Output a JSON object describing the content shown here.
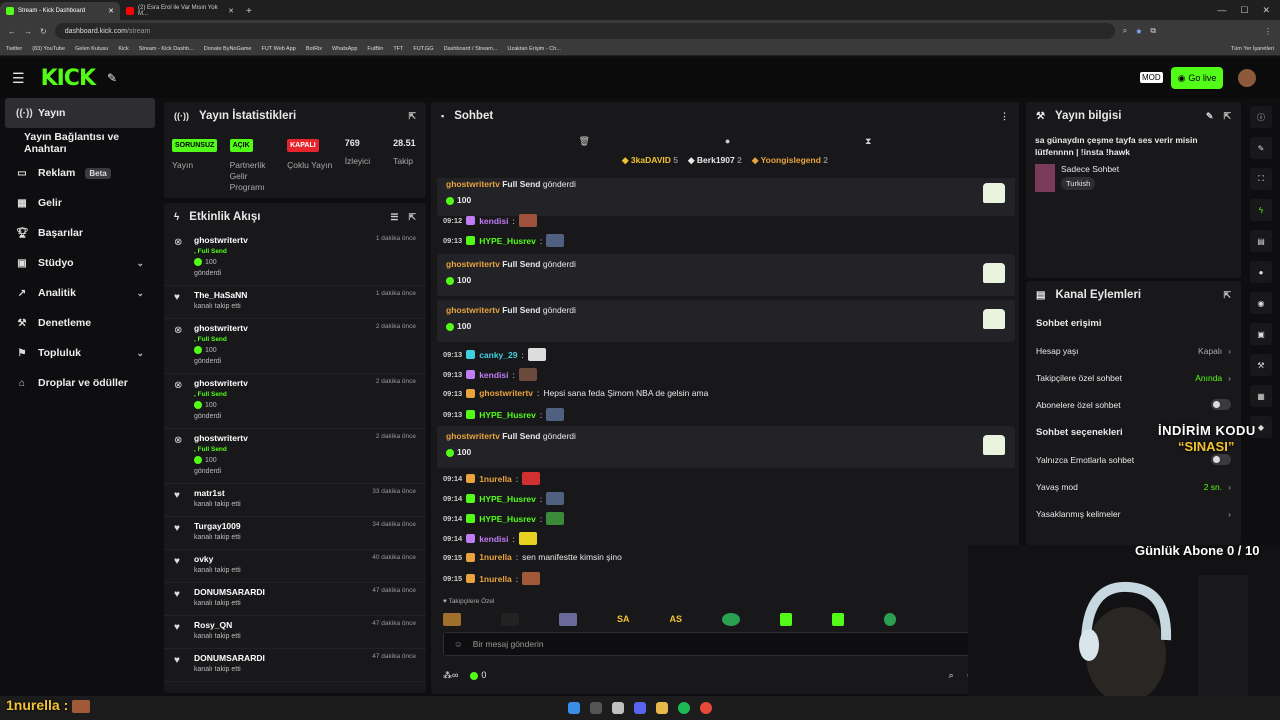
{
  "browser": {
    "tabs": [
      {
        "title": "Stream - Kick Dashboard",
        "active": true,
        "color": "#53fc18"
      },
      {
        "title": "(2) Esra Erol ile Var Mısın Yok M...",
        "active": false,
        "color": "#ff0000"
      }
    ],
    "url_host": "dashboard.kick.com",
    "url_path": "/stream",
    "bookmarks": [
      "Twitter",
      "(83) YouTube",
      "Gelen Kutusu",
      "Kick",
      "Stream - Kick Dashb...",
      "Donate ByNoGame",
      "FUT Web App",
      "BotRix",
      "WhatsApp",
      "FutBin",
      "TFT",
      "FUT.GG",
      "Dashboard / Stream...",
      "Uzaktan Erişim - Ch..."
    ],
    "all_bookmarks": "Tüm Yer İşaretleri"
  },
  "topnav": {
    "logo": "KICK",
    "go_live": "Go live"
  },
  "sidebar": {
    "items": [
      {
        "label": "Yayın",
        "icon": "broadcast-icon",
        "active": true
      },
      {
        "label": "Yayın Bağlantısı ve Anahtarı"
      },
      {
        "label": "Reklam",
        "icon": "ad-icon",
        "badge": "Beta"
      },
      {
        "label": "Gelir",
        "icon": "revenue-icon"
      },
      {
        "label": "Başarılar",
        "icon": "trophy-icon"
      },
      {
        "label": "Stüdyo",
        "icon": "studio-icon",
        "chevron": true
      },
      {
        "label": "Analitik",
        "icon": "analytics-icon",
        "chevron": true
      },
      {
        "label": "Denetleme",
        "icon": "moderation-icon"
      },
      {
        "label": "Topluluk",
        "icon": "community-icon",
        "chevron": true
      },
      {
        "label": "Droplar ve ödüller",
        "icon": "drops-icon"
      }
    ]
  },
  "stats": {
    "title": "Yayın İstatistikleri",
    "items": [
      {
        "pill": "SORUNSUZ",
        "label": "Yayın",
        "color": "#53fc18"
      },
      {
        "pill": "AÇIK",
        "label": "Partnerlik Gelir Programı",
        "color": "#53fc18"
      },
      {
        "pill": "KAPALI",
        "label": "Çoklu Yayın",
        "color": "#e5242b"
      },
      {
        "num": "769",
        "label": "İzleyici"
      },
      {
        "num": "28.51",
        "label": "Takip"
      }
    ]
  },
  "activity": {
    "title": "Etkinlik Akışı",
    "events": [
      {
        "user": "ghostwritertv",
        "gift": "Full Send",
        "amount": "100",
        "action": "gönderdi",
        "time": "1 dakika önce",
        "type": "kick"
      },
      {
        "user": "The_HaSaNN",
        "action": "kanalı takip etti",
        "time": "1 dakika önce",
        "type": "follow"
      },
      {
        "user": "ghostwritertv",
        "gift": "Full Send",
        "amount": "100",
        "action": "gönderdi",
        "time": "2 dakika önce",
        "type": "kick"
      },
      {
        "user": "ghostwritertv",
        "gift": "Full Send",
        "amount": "100",
        "action": "gönderdi",
        "time": "2 dakika önce",
        "type": "kick"
      },
      {
        "user": "ghostwritertv",
        "gift": "Full Send",
        "amount": "100",
        "action": "gönderdi",
        "time": "2 dakika önce",
        "type": "kick"
      },
      {
        "user": "matr1st",
        "action": "kanalı takip etti",
        "time": "33 dakika önce",
        "type": "follow"
      },
      {
        "user": "Turgay1009",
        "action": "kanalı takip etti",
        "time": "34 dakika önce",
        "type": "follow"
      },
      {
        "user": "ovky",
        "action": "kanalı takip etti",
        "time": "40 dakika önce",
        "type": "follow"
      },
      {
        "user": "DONUMSARARDI",
        "action": "kanalı takip etti",
        "time": "47 dakika önce",
        "type": "follow"
      },
      {
        "user": "Rosy_QN",
        "action": "kanalı takip etti",
        "time": "47 dakika önce",
        "type": "follow"
      },
      {
        "user": "DONUMSARARDI",
        "action": "kanalı takip etti",
        "time": "47 dakika önce",
        "type": "follow"
      }
    ]
  },
  "chat": {
    "title": "Sohbet",
    "top": [
      {
        "name": "3kaDAVID",
        "count": "5",
        "color": "#f2c230"
      },
      {
        "name": "Berk1907",
        "count": "2",
        "color": "#e8e8e8"
      },
      {
        "name": "Yoongislegend",
        "count": "2",
        "color": "#e8a33c"
      }
    ],
    "messages": [
      {
        "kind": "card",
        "user": "ghostwritertv",
        "gift": "Full Send",
        "action": "gönderdi",
        "amount": "100"
      },
      {
        "kind": "line",
        "time": "09:12",
        "user": "kendisi",
        "text": "",
        "color": "#c07cf5"
      },
      {
        "kind": "line",
        "time": "09:13",
        "user": "HYPE_Husrev",
        "text": "",
        "color": "#53fc18"
      },
      {
        "kind": "card",
        "user": "ghostwritertv",
        "gift": "Full Send",
        "action": "gönderdi",
        "amount": "100"
      },
      {
        "kind": "card",
        "user": "ghostwritertv",
        "gift": "Full Send",
        "action": "gönderdi",
        "amount": "100"
      },
      {
        "kind": "line",
        "time": "09:13",
        "user": "canky_29",
        "text": "",
        "color": "#3fd0e0"
      },
      {
        "kind": "line",
        "time": "09:13",
        "user": "kendisi",
        "text": "",
        "color": "#c07cf5"
      },
      {
        "kind": "line",
        "time": "09:13",
        "user": "ghostwritertv",
        "text": "Hepsi sana feda Şimom NBA de gelsin ama",
        "color": "#e8a33c"
      },
      {
        "kind": "line",
        "time": "09:13",
        "user": "HYPE_Husrev",
        "text": "",
        "color": "#53fc18"
      },
      {
        "kind": "card",
        "user": "ghostwritertv",
        "gift": "Full Send",
        "action": "gönderdi",
        "amount": "100"
      },
      {
        "kind": "line",
        "time": "09:14",
        "user": "1nurella",
        "text": "",
        "color": "#e8a33c"
      },
      {
        "kind": "line",
        "time": "09:14",
        "user": "HYPE_Husrev",
        "text": "",
        "color": "#53fc18"
      },
      {
        "kind": "line",
        "time": "09:14",
        "user": "HYPE_Husrev",
        "text": "",
        "color": "#53fc18"
      },
      {
        "kind": "line",
        "time": "09:14",
        "user": "kendisi",
        "text": "",
        "color": "#c07cf5"
      },
      {
        "kind": "line",
        "time": "09:15",
        "user": "1nurella",
        "text": "sen manifestte kimsin şino",
        "color": "#e8a33c"
      },
      {
        "kind": "line",
        "time": "09:15",
        "user": "1nurella",
        "text": "",
        "color": "#e8a33c"
      }
    ],
    "followers_only": "Takipçilere Özel",
    "input_placeholder": "Bir mesaj gönderin",
    "points": "0",
    "emotes": [
      "SA",
      "AS"
    ]
  },
  "stream_info": {
    "title": "Yayın bilgisi",
    "text": "sa günaydın çeşme tayfa ses verir misin lütfennnn | !insta !hawk",
    "category": "Sadece Sohbet",
    "tag": "Turkish"
  },
  "channel_actions": {
    "title": "Kanal Eylemleri",
    "section1": "Sohbet erişimi",
    "rows1": [
      {
        "label": "Hesap yaşı",
        "value": "Kapalı",
        "type": "chev"
      },
      {
        "label": "Takipçilere özel sohbet",
        "value": "Anında",
        "type": "chev",
        "green": true
      },
      {
        "label": "Abonelere özel sohbet",
        "type": "toggle"
      }
    ],
    "section2": "Sohbet seçenekleri",
    "rows2": [
      {
        "label": "Yalnızca Emotlarla sohbet",
        "type": "toggle"
      },
      {
        "label": "Yavaş mod",
        "value": "2 sn.",
        "type": "chev",
        "green": true
      },
      {
        "label": "Yasaklanmış kelimeler",
        "type": "chev"
      }
    ]
  },
  "overlay": {
    "promo1": "İNDİRİM KODU",
    "promo2": "“SINASI”",
    "goal": "Günlük Abone 0 / 10",
    "bottom_name": "1nurella :"
  }
}
